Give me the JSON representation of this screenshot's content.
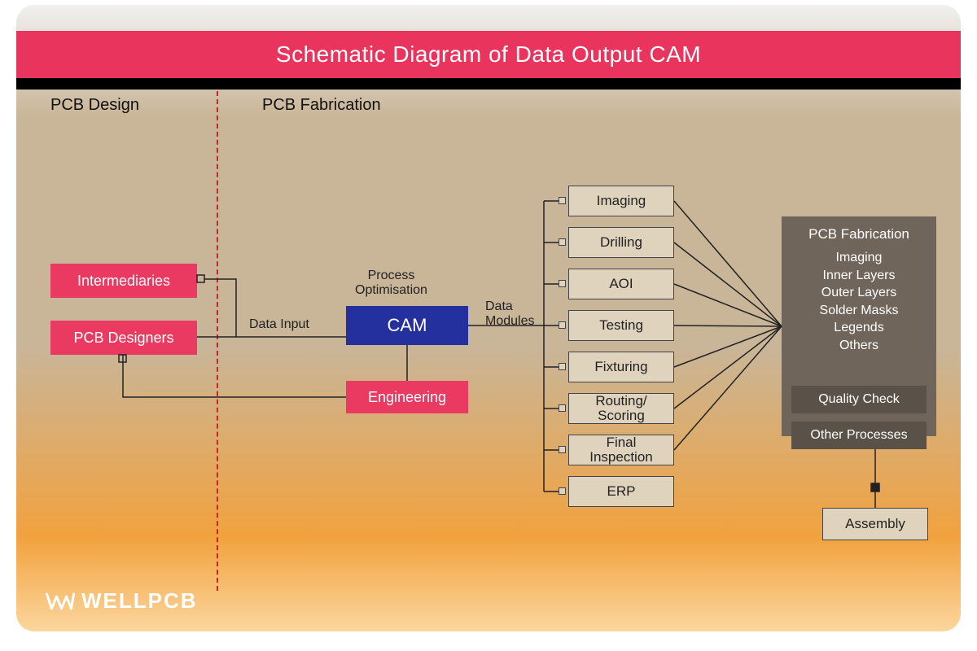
{
  "title": "Schematic Diagram of Data Output CAM",
  "sections": {
    "design": "PCB Design",
    "fabrication": "PCB Fabrication"
  },
  "inputs": {
    "intermediaries": "Intermediaries",
    "designers": "PCB Designers",
    "engineering": "Engineering",
    "data_input_label": "Data Input"
  },
  "cam": {
    "label": "CAM",
    "process_label": "Process\nOptimisation",
    "data_modules_label": "Data\nModules"
  },
  "modules": {
    "imaging": "Imaging",
    "drilling": "Drilling",
    "aoi": "AOI",
    "testing": "Testing",
    "fixturing": "Fixturing",
    "routing": "Routing/\nScoring",
    "final": "Final\nInspection",
    "erp": "ERP"
  },
  "side": {
    "header": "PCB Fabrication",
    "lines": [
      "Imaging",
      "Inner Layers",
      "Outer Layers",
      "Solder Masks",
      "Legends",
      "Others"
    ],
    "quality": "Quality Check",
    "other": "Other Processes",
    "assembly": "Assembly"
  },
  "brand": "WELLPCB"
}
